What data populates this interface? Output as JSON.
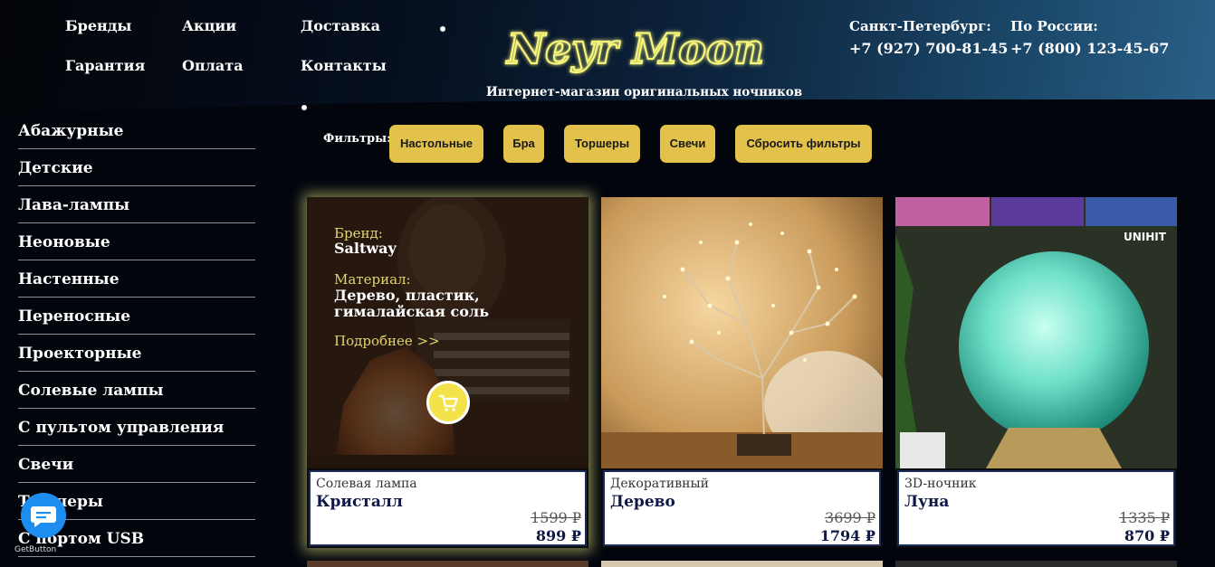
{
  "header": {
    "nav": [
      "Бренды",
      "Акции",
      "Доставка",
      "Гарантия",
      "Оплата",
      "Контакты"
    ],
    "logo_text": "Neyr Moon",
    "tagline": "Интернет-магазин оригинальных ночников",
    "contacts": [
      {
        "city": "Санкт-Петербург:",
        "phone": "+7 (927) 700-81-45"
      },
      {
        "city": "По России:",
        "phone": "+7 (800) 123-45-67"
      }
    ]
  },
  "sidebar": {
    "categories": [
      "Абажурные",
      "Детские",
      "Лава-лампы",
      "Неоновые",
      "Настенные",
      "Переносные",
      "Проекторные",
      "Солевые лампы",
      "С пультом управления",
      "Свечи",
      "Торшеры",
      "С портом USB"
    ]
  },
  "filters": {
    "label": "Фильтры:",
    "buttons": [
      "Настольные",
      "Бра",
      "Торшеры",
      "Свечи",
      "Сбросить фильтры"
    ]
  },
  "products": [
    {
      "type": "Солевая лампа",
      "name": "Кристалл",
      "old_price": "1599 ₽",
      "price": "899 ₽",
      "brand_label": "Бренд:",
      "brand": "Saltway",
      "material_label": "Материал:",
      "material_line1": "Дерево, пластик,",
      "material_line2": "гималайская соль",
      "details_link": "Подробнее >>"
    },
    {
      "type": "Декоративный",
      "name": "Дерево",
      "old_price": "3699 ₽",
      "price": "1794 ₽"
    },
    {
      "type": "3D-ночник",
      "name": "Луна",
      "old_price": "1335 ₽",
      "price": "870 ₽",
      "image_brand": "UNIHIT"
    }
  ],
  "widget": {
    "label": "GetButton"
  },
  "colors": {
    "accent": "#e2c24a",
    "logo": "#f6f57a",
    "price": "#0d1845",
    "chat": "#1e8df0"
  }
}
